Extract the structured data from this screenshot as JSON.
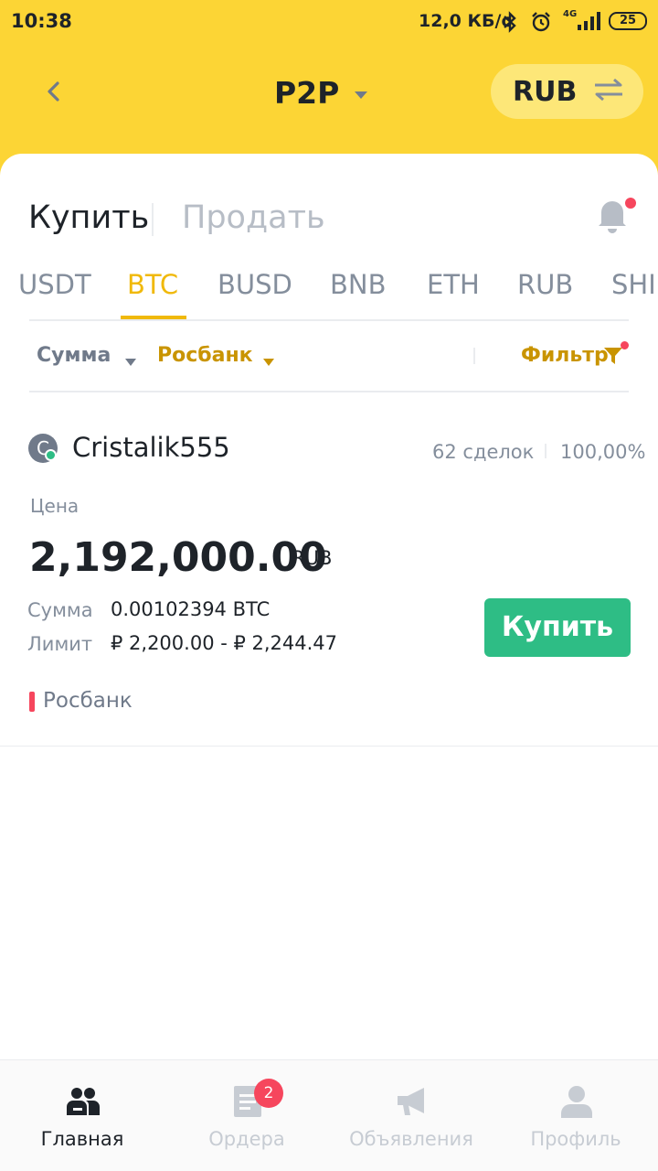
{
  "status_bar": {
    "time": "10:38",
    "net_speed": "12,0 КБ/с",
    "network": "4G",
    "battery": "25"
  },
  "header": {
    "title": "P2P",
    "fiat": "RUB"
  },
  "trade_tabs": {
    "buy": "Купить",
    "sell": "Продать",
    "active": "buy"
  },
  "coins": {
    "items": [
      "USDT",
      "BTC",
      "BUSD",
      "BNB",
      "ETH",
      "RUB",
      "SHIB"
    ],
    "active": "BTC"
  },
  "filters": {
    "amount": "Сумма",
    "payment": "Росбанк",
    "filter": "Фильтр"
  },
  "ad": {
    "avatar_letter": "C",
    "merchant": "Cristalik555",
    "orders": "62 сделок",
    "completion": "100,00%",
    "price_label": "Цена",
    "price": "2,192,000.00",
    "price_currency": "RUB",
    "amount_label": "Сумма",
    "amount_value": "0.00102394 BTC",
    "limit_label": "Лимит",
    "limit_value": "₽ 2,200.00 - ₽ 2,244.47",
    "buy_button": "Купить",
    "payment_method": "Росбанк"
  },
  "bottom_nav": {
    "items": [
      {
        "label": "Главная",
        "icon": "home-users-icon"
      },
      {
        "label": "Ордера",
        "icon": "orders-icon"
      },
      {
        "label": "Объявления",
        "icon": "megaphone-icon"
      },
      {
        "label": "Профиль",
        "icon": "profile-icon"
      }
    ],
    "orders_badge": "2",
    "active": "Главная"
  },
  "colors": {
    "brand_yellow": "#fcd535",
    "accent_gold": "#f0b90b",
    "buy_green": "#2ebd85",
    "alert_red": "#f6465d"
  }
}
